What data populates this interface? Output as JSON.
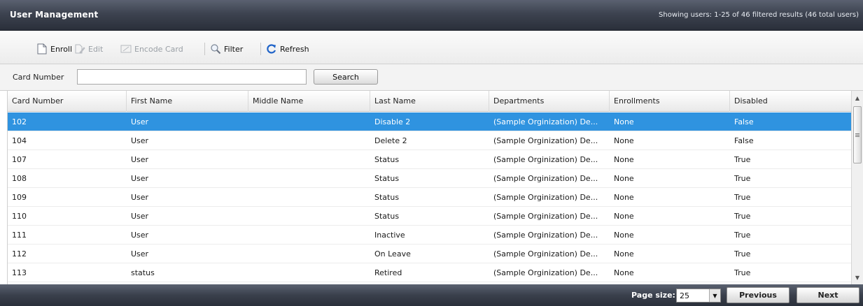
{
  "window": {
    "title": "User Management",
    "status": "Showing users: 1-25 of 46 filtered results (46 total users)"
  },
  "toolbar": {
    "enroll_label": "Enroll",
    "edit_label": "Edit",
    "encode_label": "Encode Card",
    "filter_label": "Filter",
    "refresh_label": "Refresh"
  },
  "search": {
    "label": "Card Number",
    "value": "",
    "placeholder": "",
    "button_label": "Search"
  },
  "grid": {
    "columns": [
      "Card Number",
      "First Name",
      "Middle Name",
      "Last Name",
      "Departments",
      "Enrollments",
      "Disabled"
    ],
    "rows": [
      {
        "card": "102",
        "first": "User",
        "middle": "",
        "last": "Disable 2",
        "dept": "(Sample Orginization) De...",
        "enroll": "None",
        "disabled": "False"
      },
      {
        "card": "104",
        "first": "User",
        "middle": "",
        "last": "Delete 2",
        "dept": "(Sample Orginization) De...",
        "enroll": "None",
        "disabled": "False"
      },
      {
        "card": "107",
        "first": "User",
        "middle": "",
        "last": "Status",
        "dept": "(Sample Orginization) De...",
        "enroll": "None",
        "disabled": "True"
      },
      {
        "card": "108",
        "first": "User",
        "middle": "",
        "last": "Status",
        "dept": "(Sample Orginization) De...",
        "enroll": "None",
        "disabled": "True"
      },
      {
        "card": "109",
        "first": "User",
        "middle": "",
        "last": "Status",
        "dept": "(Sample Orginization) De...",
        "enroll": "None",
        "disabled": "True"
      },
      {
        "card": "110",
        "first": "User",
        "middle": "",
        "last": "Status",
        "dept": "(Sample Orginization) De...",
        "enroll": "None",
        "disabled": "True"
      },
      {
        "card": "111",
        "first": "User",
        "middle": "",
        "last": "Inactive",
        "dept": "(Sample Orginization) De...",
        "enroll": "None",
        "disabled": "True"
      },
      {
        "card": "112",
        "first": "User",
        "middle": "",
        "last": "On Leave",
        "dept": "(Sample Orginization) De...",
        "enroll": "None",
        "disabled": "True"
      },
      {
        "card": "113",
        "first": "status",
        "middle": "",
        "last": "Retired",
        "dept": "(Sample Orginization) De...",
        "enroll": "None",
        "disabled": "True"
      }
    ]
  },
  "footer": {
    "page_size_label": "Page size:",
    "page_size_value": "25",
    "previous_label": "Previous",
    "next_label": "Next"
  },
  "colors": {
    "header_bar": "#3d4350",
    "selection": "#2f93e0",
    "refresh_icon": "#1f63c8"
  },
  "icons": {
    "enroll": "new-document-icon",
    "edit": "edit-document-icon",
    "encode": "card-icon",
    "filter": "magnifier-icon",
    "refresh": "refresh-icon"
  }
}
